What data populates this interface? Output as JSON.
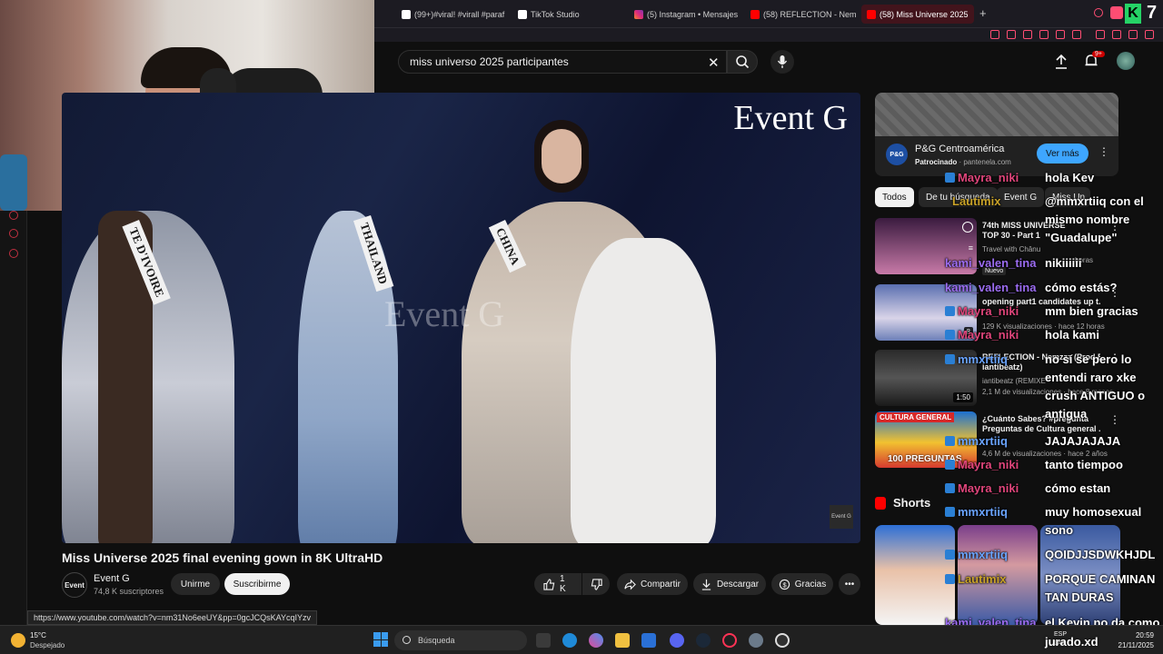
{
  "browser": {
    "tabs": [
      {
        "label": "(99+)#viral! #virall #paraf",
        "icon": "tiktok-icon"
      },
      {
        "label": "TikTok Studio",
        "icon": "tiktok-icon"
      },
      {
        "label": "(5) Instagram • Mensajes",
        "icon": "instagram-icon"
      },
      {
        "label": "(58) REFLECTION - Nem",
        "icon": "youtube-icon"
      },
      {
        "label": "(58) Miss Universe 2025",
        "icon": "youtube-icon",
        "active": true
      }
    ],
    "new_tab": "+",
    "stream_counter": "7",
    "status_url": "https://www.youtube.com/watch?v=nm31No6eeUY&pp=0gcJCQsKAYcqIYzv"
  },
  "youtube": {
    "search_value": "miss universo 2025 participantes",
    "notifications_count": "9+",
    "video": {
      "watermark": "Event G",
      "sashes": [
        "TE D'IVOIRE",
        "THAILAND",
        "CHINA"
      ],
      "corner_logo": "Event G"
    },
    "title": "Miss Universe 2025 final evening gown in 8K UltraHD",
    "channel": {
      "avatar_text": "Event",
      "name": "Event G",
      "subscribers": "74,8 K suscriptores",
      "join_label": "Unirme",
      "subscribe_label": "Suscribirme"
    },
    "actions": {
      "likes": "1 K",
      "share": "Compartir",
      "download": "Descargar",
      "thanks": "Gracias"
    },
    "ad": {
      "logo": "P&G",
      "name": "P&G Centroamérica",
      "sponsored": "Patrocinado",
      "domain": "pantenela.com",
      "cta": "Ver más"
    },
    "chips": [
      "Todos",
      "De tu búsqueda",
      "Event G",
      "Miss Un"
    ],
    "recommendations": [
      {
        "title1": "74th MISS UNIVERSE",
        "title2": "TOP 30 - Part 1",
        "channel": "Travel with Chânu",
        "meta": "horas",
        "badge": "Nuevo",
        "duration": ""
      },
      {
        "title1": "",
        "title2": "opening part1 candidates up t...",
        "channel": "",
        "meta": "129 K visualizaciones · hace 12 horas",
        "badge": "",
        "duration": "8"
      },
      {
        "title1": "REFLECTION - Nemzzz (Prod By",
        "title2": "iantibeatz)",
        "channel": "iantibeatz (REMIXE",
        "meta": "2,1 M de visualizaciones · hace 8 meses",
        "badge": "",
        "duration": "1:50"
      },
      {
        "title1": "¿Cuánto Sabes? #pregunta",
        "title2": "Preguntas de Cultura general ...",
        "channel": "",
        "meta": "4,6 M de visualizaciones · hace 2 años",
        "badge": "",
        "duration": "",
        "thumb_text1": "CULTURA GENERAL",
        "thumb_text2": "100 PREGUNTAS"
      }
    ],
    "shorts_label": "Shorts"
  },
  "chat": [
    {
      "user": "Mayra_niki",
      "color": "#e0457b",
      "msg": "hola Kev"
    },
    {
      "user": "Lautimix",
      "color": "#c9a227",
      "msg": "@mmxrtiiq con el mismo nombre \"Guadalupe\""
    },
    {
      "user": "kami_valen_tina",
      "color": "#9b6cf0",
      "msg": "nikiiiiii"
    },
    {
      "user": "kami_valen_tina",
      "color": "#9b6cf0",
      "msg": "cómo estás?"
    },
    {
      "user": "Mayra_niki",
      "color": "#e0457b",
      "msg": "mm bien gracias"
    },
    {
      "user": "Mayra_niki",
      "color": "#e0457b",
      "msg": "hola kami"
    },
    {
      "user": "mmxrtiiq",
      "color": "#6aa4ff",
      "msg": "no sí se pero lo entendi raro xke crush ANTIGUO o antigua"
    },
    {
      "user": "mmxrtiiq",
      "color": "#6aa4ff",
      "msg": "JAJAJAJAJA"
    },
    {
      "user": "Mayra_niki",
      "color": "#e0457b",
      "msg": "tanto tiempoo"
    },
    {
      "user": "Mayra_niki",
      "color": "#e0457b",
      "msg": "cómo estan"
    },
    {
      "user": "mmxrtiiq",
      "color": "#6aa4ff",
      "msg": "muy homosexual sono"
    },
    {
      "user": "mmxrtiiq",
      "color": "#6aa4ff",
      "msg": "QOIDJJSDWKHJDL"
    },
    {
      "user": "Lautimix",
      "color": "#c9a227",
      "msg": "PORQUE CAMINAN TAN DURAS"
    },
    {
      "user": "kami_valen_tina",
      "color": "#9b6cf0",
      "msg": "el Kevin no da como"
    }
  ],
  "taskbar": {
    "temperature": "15°C",
    "condition": "Despejado",
    "search_placeholder": "Búsqueda",
    "lang_line1": "ESP",
    "lang_line2": "LAA",
    "time": "20:59",
    "date": "21/11/2025",
    "overlay_name": "jurado.xd"
  }
}
